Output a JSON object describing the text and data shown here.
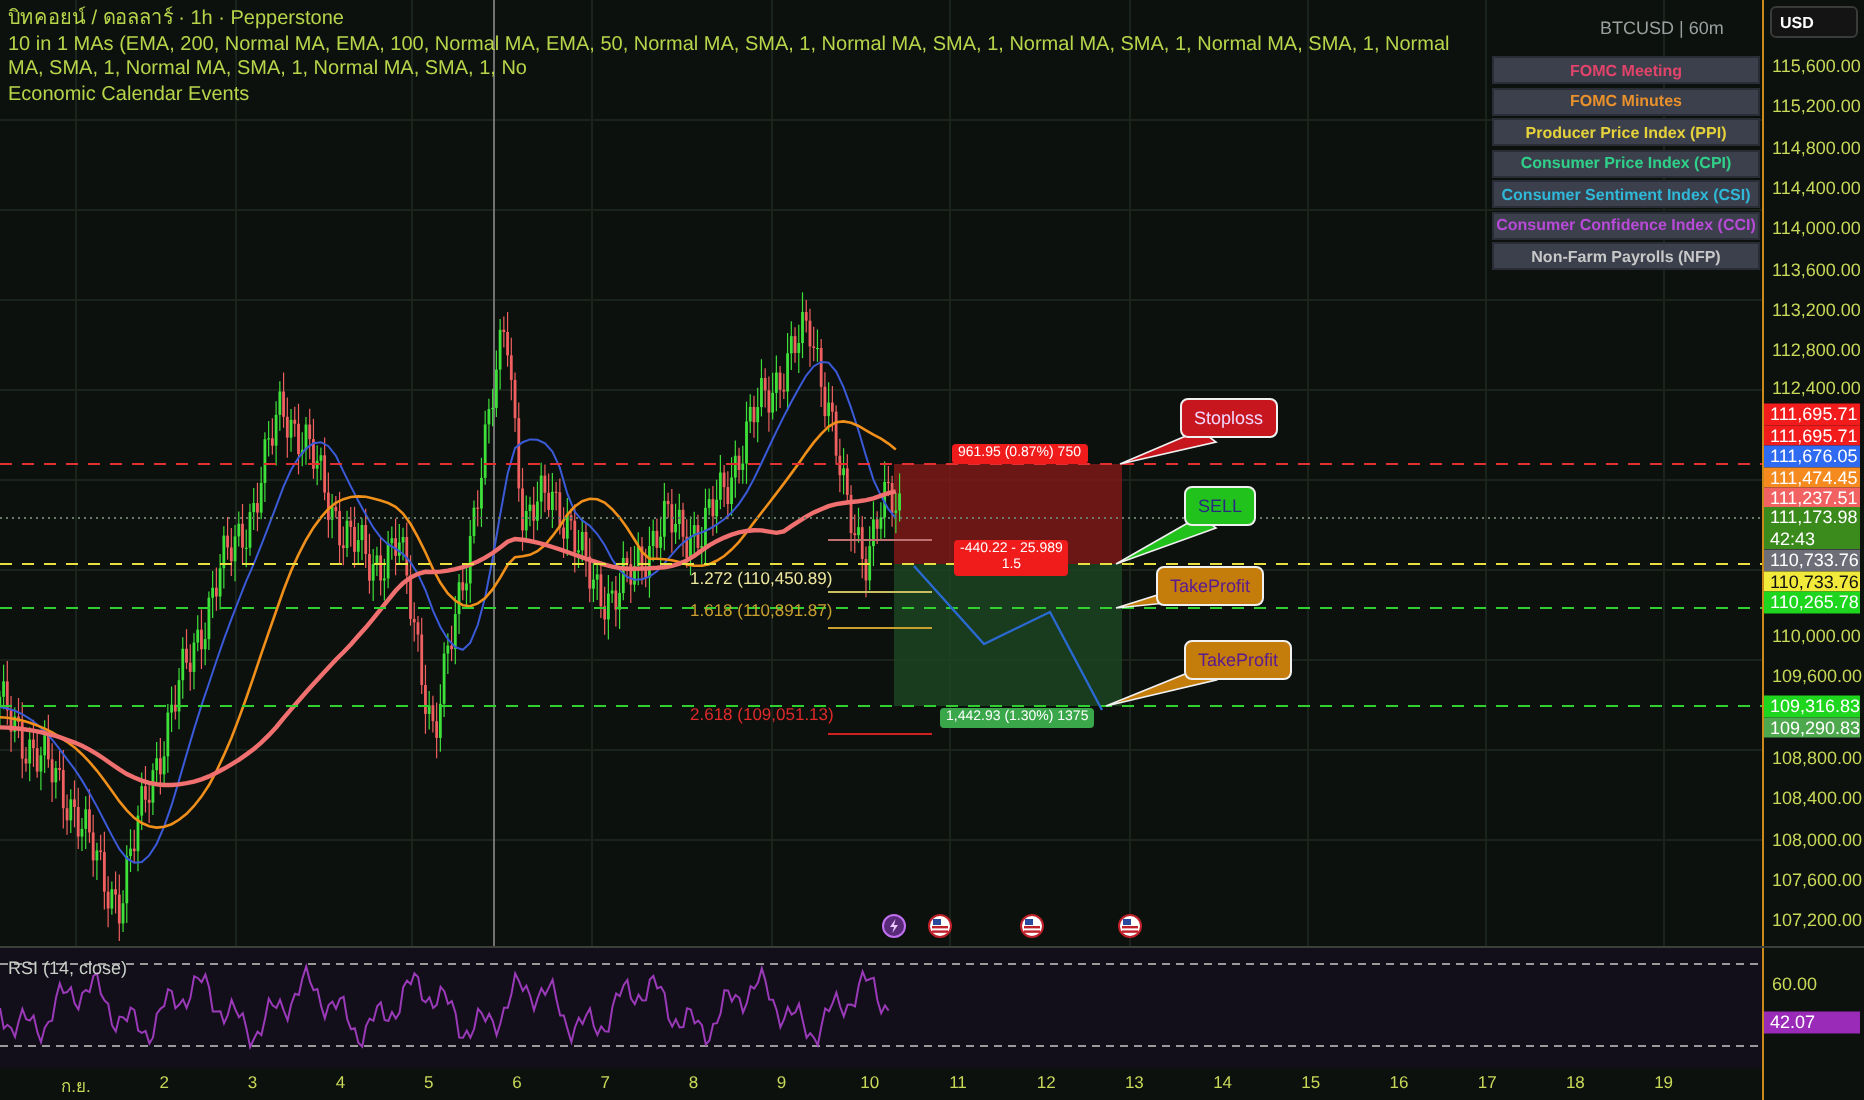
{
  "legend": {
    "title": "บิทคอยน์ / ดอลลาร์ · 1h · Pepperstone",
    "indicator": "10 in 1 MAs (EMA, 200, Normal MA, EMA, 100, Normal MA, EMA, 50, Normal MA, SMA, 1, Normal MA, SMA, 1, Normal MA, SMA, 1, Normal MA, SMA, 1, Normal MA, SMA, 1, Normal MA, SMA, 1, Normal MA, SMA, 1, No",
    "calendar": "Economic Calendar Events"
  },
  "symbol": "BTCUSD | 60m",
  "currency": "USD",
  "events": [
    {
      "label": "FOMC Meeting",
      "color": "#e0446a"
    },
    {
      "label": "FOMC Minutes",
      "color": "#e8902c"
    },
    {
      "label": "Producer Price Index (PPI)",
      "color": "#e6d23a"
    },
    {
      "label": "Consumer Price Index (CPI)",
      "color": "#2fd08a"
    },
    {
      "label": "Consumer Sentiment Index (CSI)",
      "color": "#2fb8d8"
    },
    {
      "label": "Consumer Confidence Index (CCI)",
      "color": "#b84ad8"
    },
    {
      "label": "Non-Farm Payrolls (NFP)",
      "color": "#c8c8c8"
    }
  ],
  "price_axis": [
    "115,600.00",
    "115,200.00",
    "114,800.00",
    "114,400.00",
    "114,000.00",
    "113,600.00",
    "113,200.00",
    "112,800.00",
    "112,400.00",
    "110,000.00",
    "109,600.00",
    "108,800.00",
    "108,400.00",
    "108,000.00",
    "107,600.00",
    "107,200.00"
  ],
  "price_badges": [
    {
      "price": "111,695.71",
      "color": "#f21c1c"
    },
    {
      "price": "111,695.71",
      "color": "#f21c1c"
    },
    {
      "price": "111,676.05",
      "color": "#2f6bf0"
    },
    {
      "price": "111,474.45",
      "color": "#f58a1f"
    },
    {
      "price": "111,237.51",
      "color": "#f26262"
    },
    {
      "price": "111,173.98",
      "countdown": "42:43",
      "color": "#3a8a1c"
    },
    {
      "price": "110,733.76",
      "color": "#6e6e78"
    },
    {
      "price": "110,733.76",
      "color": "#f2ea3a"
    },
    {
      "price": "110,265.78",
      "color": "#1fd61f"
    },
    {
      "price": "109,316.83",
      "color": "#1fd61f"
    },
    {
      "price": "109,290.83",
      "color": "#4ea84e"
    }
  ],
  "position_tool": {
    "stop_label": "961.95 (0.87%) 750",
    "entry_label": "-440.22 - 25.989",
    "entry_ratio": "1.5",
    "target_label": "1,442.93 (1.30%) 1375"
  },
  "fib_levels": [
    {
      "label": "1.272 (110,450.89)",
      "color": "#f0eaa0"
    },
    {
      "label": "1.618 (110,891.87)",
      "color": "#c8a030"
    },
    {
      "label": "2.618 (109,051.13)",
      "color": "#e02a2a"
    }
  ],
  "callouts": [
    {
      "kind": "stop",
      "text": "Stoploss"
    },
    {
      "kind": "sell",
      "text": "SELL"
    },
    {
      "kind": "take-profit",
      "text": "TakeProfit"
    },
    {
      "kind": "take-profit",
      "text": "TakeProfit"
    }
  ],
  "event_markers": [
    {
      "kind": "lightning"
    },
    {
      "kind": "flag"
    },
    {
      "kind": "flag"
    },
    {
      "kind": "flag"
    }
  ],
  "rsi": {
    "label": "RSI (14, close)",
    "axis": "60.00",
    "value": "42.07"
  },
  "time_axis": [
    "ก.ย.",
    "2",
    "3",
    "4",
    "5",
    "6",
    "7",
    "8",
    "9",
    "10",
    "11",
    "12",
    "13",
    "14",
    "15",
    "16",
    "17",
    "18",
    "19"
  ]
}
